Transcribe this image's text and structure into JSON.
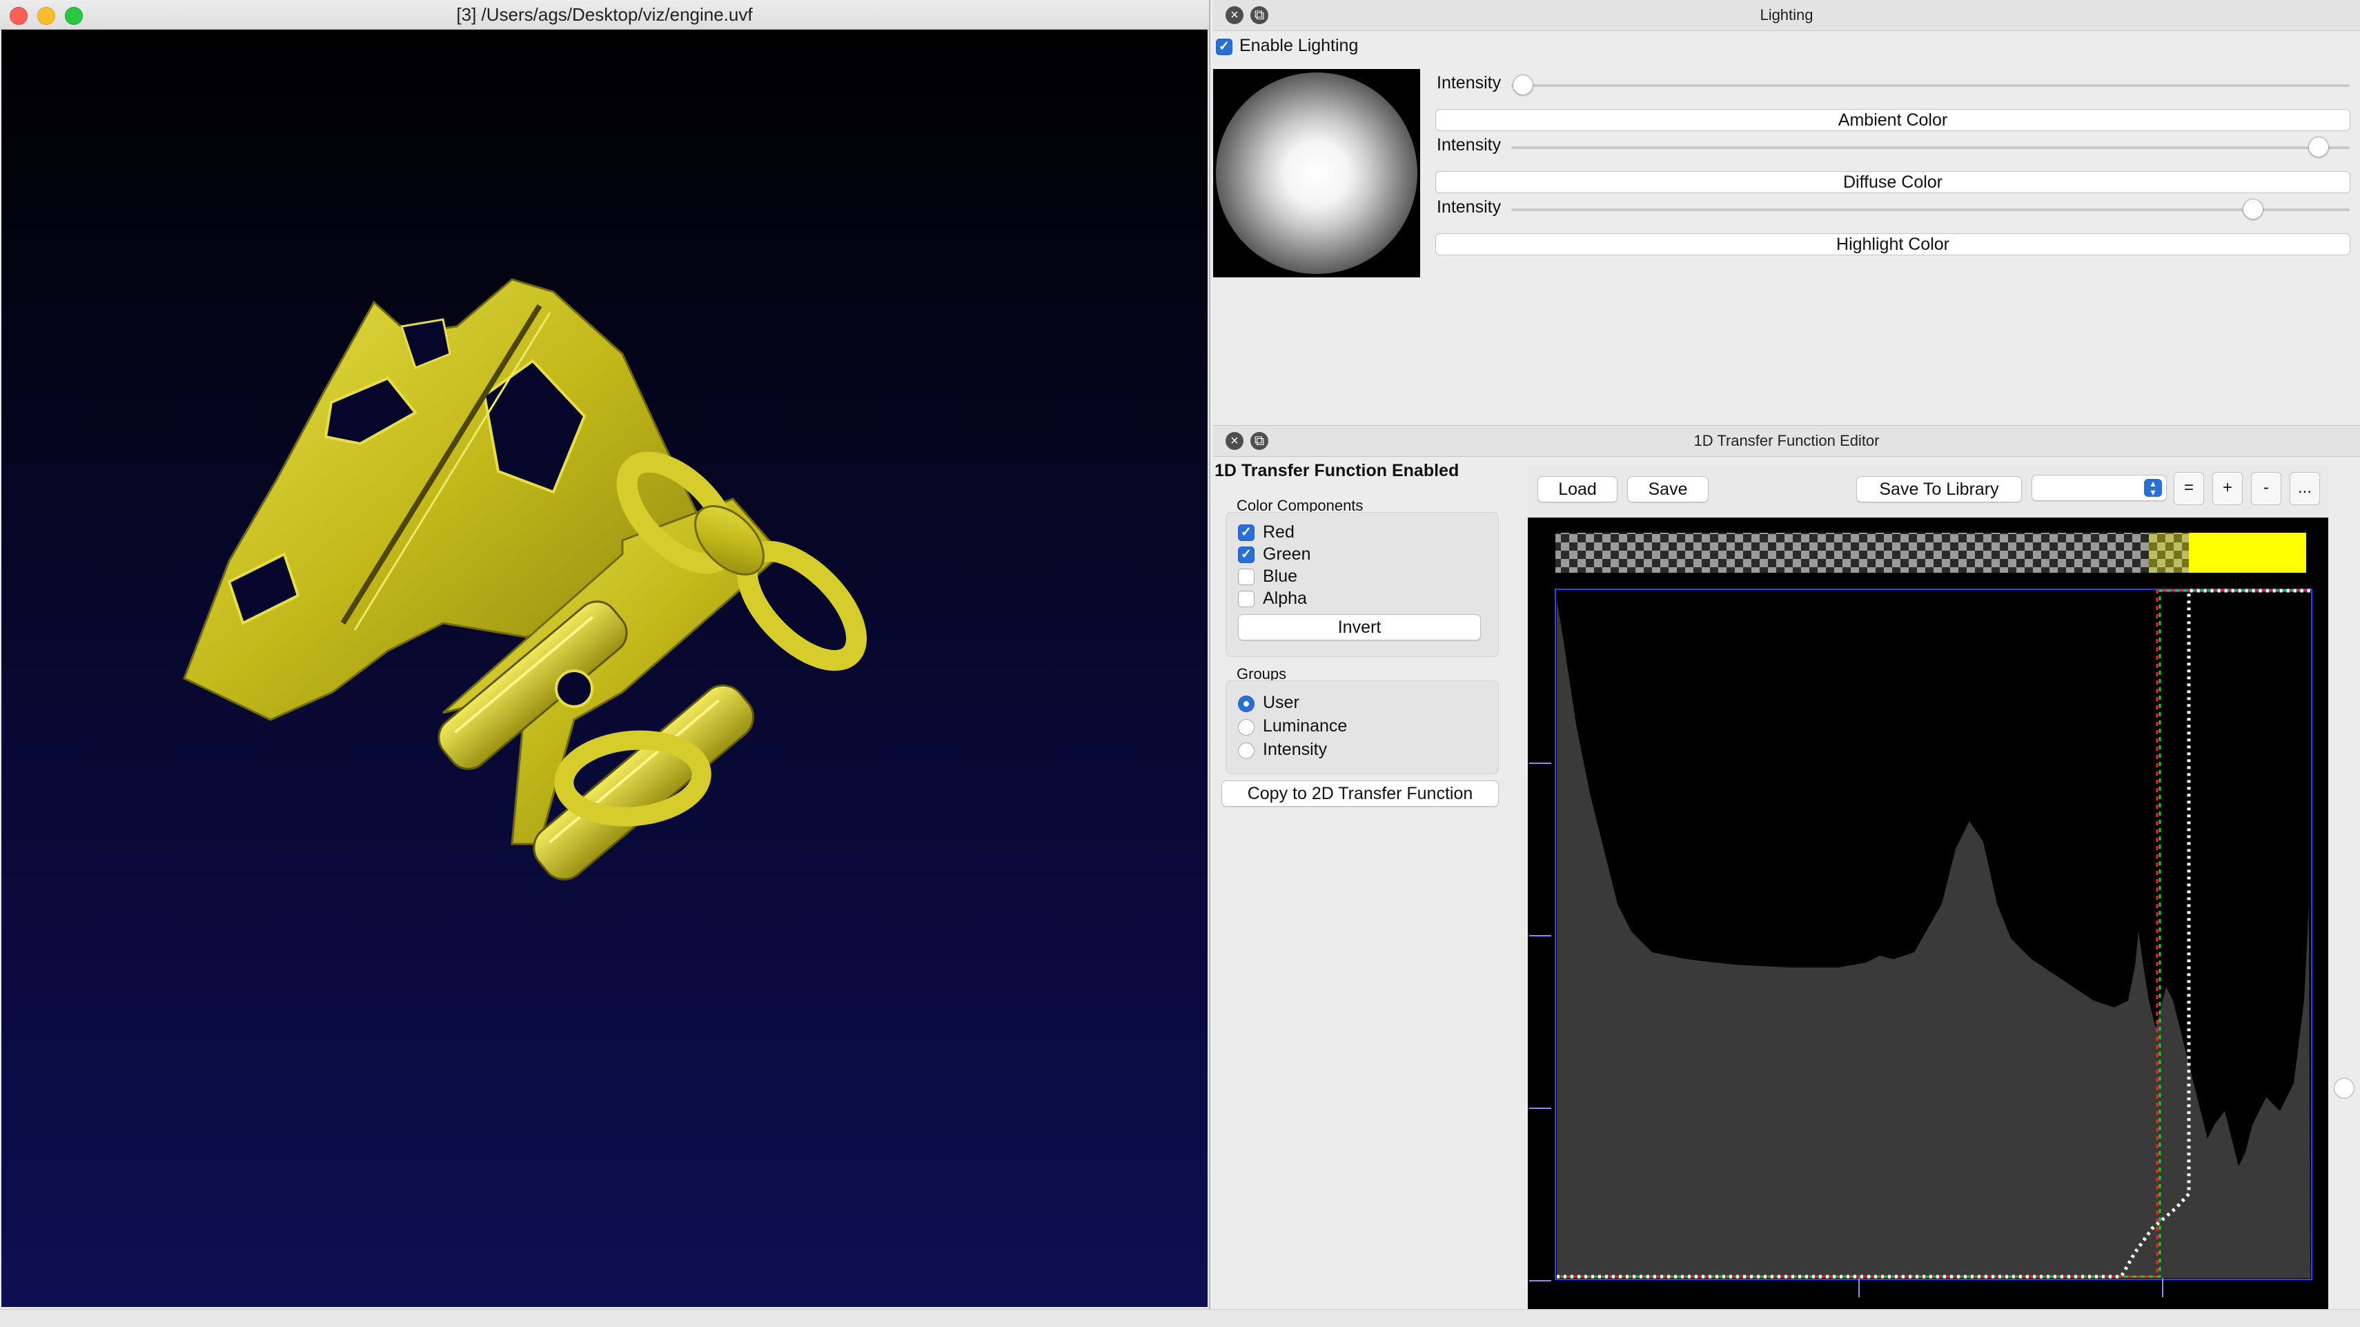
{
  "render_window": {
    "title": "[3] /Users/ags/Desktop/viz/engine.uvf",
    "accent_color": "#c9c01a",
    "background_top": "#000000",
    "background_bottom": "#0e0e52"
  },
  "lighting": {
    "title": "Lighting",
    "enable_label": "Enable Lighting",
    "enabled": true,
    "intensity_label": "Intensity",
    "ambient": {
      "intensity": 0.01,
      "button": "Ambient Color"
    },
    "diffuse": {
      "intensity": 0.95,
      "button": "Diffuse Color"
    },
    "highlight": {
      "intensity": 0.87,
      "button": "Highlight Color"
    }
  },
  "tf_editor": {
    "title": "1D Transfer Function Editor",
    "status": "1D Transfer Function Enabled",
    "color_components": {
      "title": "Color Components",
      "items": [
        {
          "label": "Red",
          "checked": true
        },
        {
          "label": "Green",
          "checked": true
        },
        {
          "label": "Blue",
          "checked": false
        },
        {
          "label": "Alpha",
          "checked": false
        }
      ],
      "invert": "Invert"
    },
    "groups": {
      "title": "Groups",
      "items": [
        {
          "label": "User",
          "selected": true
        },
        {
          "label": "Luminance",
          "selected": false
        },
        {
          "label": "Intensity",
          "selected": false
        }
      ]
    },
    "copy_button": "Copy to 2D Transfer Function",
    "toolbar": {
      "load": "Load",
      "save": "Save",
      "save_library": "Save To Library",
      "select_value": "",
      "btn_equal": "=",
      "btn_plus": "+",
      "btn_minus": "-",
      "btn_more": "..."
    },
    "colors": {
      "curve_red": "#ff2020",
      "curve_green": "#20d020",
      "curve_alpha": "#ffffff",
      "histogram_fill": "#3a3a3a",
      "axis_color": "#3a3aff",
      "swatch": "#ffff00"
    },
    "transfer_function": {
      "threshold": 0.79,
      "alpha_ramp_start": 0.74,
      "alpha_step": 0.84,
      "alpha_max": 1.0
    }
  }
}
